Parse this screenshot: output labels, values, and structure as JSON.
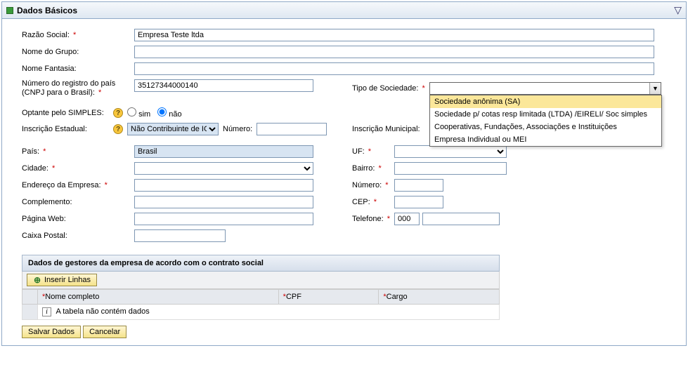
{
  "panel": {
    "title": "Dados Básicos"
  },
  "labels": {
    "razao_social": "Razão Social:",
    "nome_grupo": "Nome do Grupo:",
    "nome_fantasia": "Nome Fantasia:",
    "numero_registro_l1": "Número do registro do país",
    "numero_registro_l2": "(CNPJ para o Brasil):",
    "tipo_sociedade": "Tipo de Sociedade:",
    "optante_simples": "Optante pelo SIMPLES:",
    "inscricao_estadual": "Inscrição Estadual:",
    "ie_numero": "Número:",
    "inscricao_municipal": "Inscrição Municipal:",
    "pais": "País:",
    "uf": "UF:",
    "cidade": "Cidade:",
    "bairro": "Bairro:",
    "endereco": "Endereço da Empresa:",
    "numero": "Número:",
    "complemento": "Complemento:",
    "cep": "CEP:",
    "pagina_web": "Página Web:",
    "telefone": "Telefone:",
    "caixa_postal": "Caixa Postal:",
    "sim": "sim",
    "nao": "não"
  },
  "values": {
    "razao_social": "Empresa Teste ltda",
    "cnpj": "35127344000140",
    "inscricao_estadual_sel": "Não Contribuinte de IC...",
    "pais": "Brasil",
    "telefone_ddd": "000",
    "simples_selected": "nao"
  },
  "tipo_sociedade_options": [
    "Sociedade anônima (SA)",
    "Sociedade p/ cotas resp limitada (LTDA) /EIRELI/ Soc simples",
    "Cooperativas, Fundações, Associações e Instituições",
    "Empresa Individual ou MEI"
  ],
  "gestores": {
    "header": "Dados de gestores da empresa de acordo com o contrato social",
    "insert_btn": "Inserir Linhas",
    "columns": {
      "nome": "Nome completo",
      "cpf": "CPF",
      "cargo": "Cargo"
    },
    "empty": "A tabela não contém dados"
  },
  "buttons": {
    "salvar": "Salvar Dados",
    "cancelar": "Cancelar"
  },
  "help": "?"
}
